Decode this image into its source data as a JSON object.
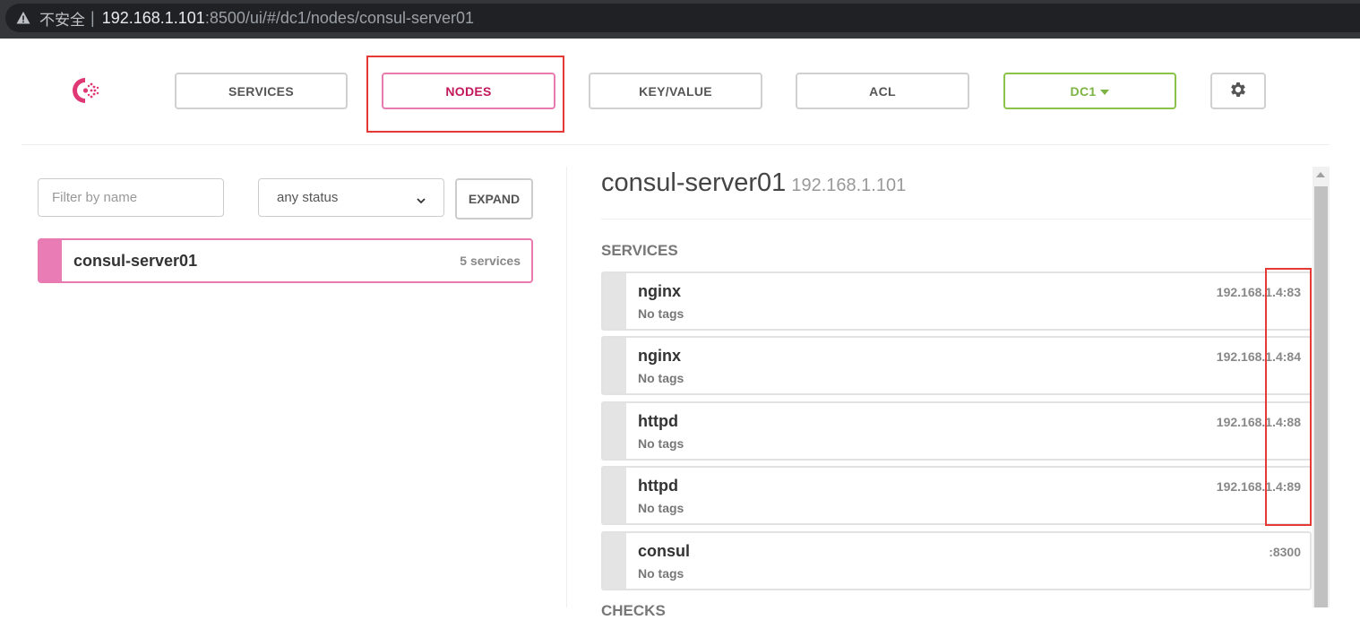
{
  "browser": {
    "insecure_label": "不安全",
    "separator": "|",
    "url_host": "192.168.1.101",
    "url_rest": ":8500/ui/#/dc1/nodes/consul-server01"
  },
  "nav": {
    "services": "SERVICES",
    "nodes": "NODES",
    "keyvalue": "KEY/VALUE",
    "acl": "ACL",
    "dc": "DC1"
  },
  "colors": {
    "brand": "#e03875",
    "active": "#c2185b",
    "dc": "#7cb342",
    "highlight": "#e53935"
  },
  "filters": {
    "placeholder": "Filter by name",
    "status": "any status",
    "expand": "EXPAND"
  },
  "nodes": [
    {
      "name": "consul-server01",
      "count": "5 services"
    }
  ],
  "detail": {
    "name": "consul-server01",
    "ip": "192.168.1.101",
    "services_heading": "SERVICES",
    "checks_heading": "CHECKS"
  },
  "services": [
    {
      "name": "nginx",
      "tags": "No tags",
      "address": "192.168.1.4:83"
    },
    {
      "name": "nginx",
      "tags": "No tags",
      "address": "192.168.1.4:84"
    },
    {
      "name": "httpd",
      "tags": "No tags",
      "address": "192.168.1.4:88"
    },
    {
      "name": "httpd",
      "tags": "No tags",
      "address": "192.168.1.4:89"
    },
    {
      "name": "consul",
      "tags": "No tags",
      "address": ":8300"
    }
  ]
}
